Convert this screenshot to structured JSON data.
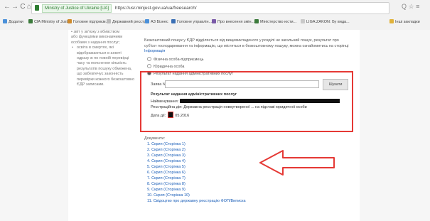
{
  "browser": {
    "back_glyph": "←",
    "forward_glyph": "→",
    "reload_glyph": "C",
    "home_glyph": "⌂",
    "secure_label": "Ministry of Justice of Ukraine [UA]",
    "url": "https://usr.minjust.gov.ua/ua/freesearch/",
    "right_icons": "Q ☆ ≡"
  },
  "bookmarks": [
    {
      "label": "Додатки",
      "color": "#4a90d9"
    },
    {
      "label": "CfA Ministry of Just...",
      "color": "#3b7a3b"
    },
    {
      "label": "Головне підприєм...",
      "color": "#d08a2a"
    },
    {
      "label": "Державний реєстр...",
      "color": "#bbbbbb"
    },
    {
      "label": "АЗ Бізнес",
      "color": "#4a90d9"
    },
    {
      "label": "Головне управлін...",
      "color": "#3a6fb5"
    },
    {
      "label": "Про внесення змін...",
      "color": "#7a5aa8"
    },
    {
      "label": "Міністерство юсти...",
      "color": "#3b7a3b"
    },
    {
      "label": "LIGA:ZAKON: Бу вида...",
      "color": "#c9c9c9"
    },
    {
      "label": "Інші закладки",
      "color": "#e0b23a"
    }
  ],
  "sidebar": {
    "lines": [
      "• звіт у зв'язку з вбивством",
      "  або функціями виконавчими",
      "  особами з надання послуг;"
    ],
    "bullet_lines": [
      "освіта в смертях, які",
      "відображаються в анкеті",
      "одразу ж по повній перевірці",
      "часу та пояснення кількість",
      "результатів пошуку обмежена,",
      "що забезпечує законність",
      "перевірки кожного безкоштовно",
      "ЄДР записами."
    ]
  },
  "main": {
    "intro": "Безкоштовний пошук у ЄДР відділяється від вищевикладеного у розділі не загальний пошук, результат про суб'єкт господарювання та інформацію, що містяться в безкоштовному пошуку, можна ознайомитись на сторінці",
    "intro_link": "Інформація",
    "options": [
      "Фізична особа-підприємець",
      "Юридична особа",
      "Результат надання адміністративних послуг"
    ],
    "search_label": "Заява №",
    "search_value": "",
    "search_button": "Шукати",
    "result_title": "Результат надання адміністративних послуг",
    "result_name_label": "Найменування:",
    "result_line": "Реєстраційна дія: Державна реєстрація новоутвореної ... на підставі юридичної особи",
    "result_date_label": "Дата дії:",
    "result_date_value": "05.2016",
    "docs_title": "Документи:",
    "links": [
      "1. Скрип (Сторінка 1)",
      "2. Скрип (Сторінка 2)",
      "3. Скрип (Сторінка 3)",
      "4. Скрип (Сторінка 4)",
      "5. Скрип (Сторінка 5)",
      "6. Скрип (Сторінка 6)",
      "7. Скрип (Сторінка 7)",
      "8. Скрип (Сторінка 8)",
      "9. Скрип (Сторінка 9)",
      "10. Скрип (Сторінка 10)",
      "11. Свідоцтво про державну реєстрацію ФОП/Виписка"
    ]
  },
  "colors": {
    "highlight": "#e53935",
    "link": "#1a5eb8"
  }
}
